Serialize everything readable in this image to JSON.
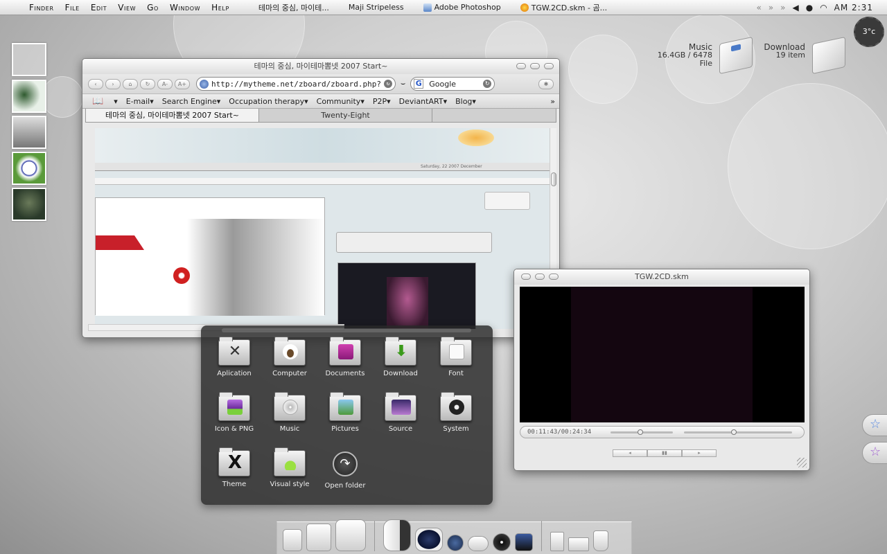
{
  "menubar": {
    "apple": "",
    "menus": [
      "Finder",
      "File",
      "Edit",
      "View",
      "Go",
      "Window",
      "Help"
    ],
    "tasks": [
      {
        "label": "테마의 중심, 마이테...",
        "icon": "none"
      },
      {
        "label": "Maji Stripeless",
        "icon": "none"
      },
      {
        "label": "Adobe Photoshop",
        "icon": "photoshop-icon"
      },
      {
        "label": "TGW.2CD.skm - 곰...",
        "icon": "gom-player-icon"
      }
    ],
    "clock": "AM 2:31"
  },
  "widgets": {
    "music": {
      "title": "Music",
      "detail": "16.4GB / 6478 File"
    },
    "download": {
      "title": "Download",
      "detail": "19 item"
    },
    "temperature": "3°c"
  },
  "browser": {
    "title": "테마의 중심, 마이테마뽐넷 2007 Start~",
    "url": "http://mytheme.net/zboard/zboard.php?id=",
    "search_engine": "Google",
    "nav_buttons": [
      "back",
      "forward",
      "home",
      "reload",
      "A-",
      "A+"
    ],
    "bookmarks": [
      {
        "label": "E-mail"
      },
      {
        "label": "Search Engine"
      },
      {
        "label": "Occupation therapy"
      },
      {
        "label": "Community"
      },
      {
        "label": "P2P"
      },
      {
        "label": "DeviantART"
      },
      {
        "label": "Blog"
      }
    ],
    "tabs": [
      {
        "label": "테마의 중심, 마이테마뽐넷 2007 Start~",
        "active": true
      },
      {
        "label": "Twenty-Eight",
        "active": false
      }
    ],
    "page_inner_date": "Saturday, 22 2007 December"
  },
  "folder_panel": {
    "items": [
      {
        "label": "Aplication",
        "icon": "application-folder-icon",
        "color": "#444444"
      },
      {
        "label": "Computer",
        "icon": "computer-folder-icon",
        "color": "#8a6a4a"
      },
      {
        "label": "Documents",
        "icon": "documents-folder-icon",
        "color": "#b02a8e"
      },
      {
        "label": "Download",
        "icon": "download-folder-icon",
        "color": "#4aa02a"
      },
      {
        "label": "Font",
        "icon": "font-folder-icon",
        "color": "#f4f4f4"
      },
      {
        "label": "Icon & PNG",
        "icon": "icon-png-folder-icon",
        "color": "#9b4fc7"
      },
      {
        "label": "Music",
        "icon": "music-folder-icon",
        "color": "#cfcfcf"
      },
      {
        "label": "Pictures",
        "icon": "pictures-folder-icon",
        "color": "#4e9a3a"
      },
      {
        "label": "Source",
        "icon": "source-folder-icon",
        "color": "#7a5ab8"
      },
      {
        "label": "System",
        "icon": "system-folder-icon",
        "color": "#333333"
      },
      {
        "label": "Theme",
        "icon": "theme-folder-icon",
        "color": "#222222"
      },
      {
        "label": "Visual style",
        "icon": "visual-style-folder-icon",
        "color": "#8fd43a"
      },
      {
        "label": "Open folder",
        "icon": "open-folder-icon",
        "color": "#444444"
      }
    ]
  },
  "player": {
    "title": "TGW.2CD.skm",
    "time": "00:11:43/00:24:34",
    "seek_fraction": 0.48,
    "volume_fraction": 0.46,
    "buttons": [
      "prev",
      "pause",
      "next"
    ]
  },
  "dock": {
    "items": [
      "windows-app",
      "folders-app",
      "media-player",
      "visualizer",
      "user",
      "network",
      "dvd",
      "monitor",
      "documents",
      "print",
      "trash"
    ]
  },
  "side_tabs": [
    "favorite-star-blue",
    "favorite-star-purple"
  ]
}
